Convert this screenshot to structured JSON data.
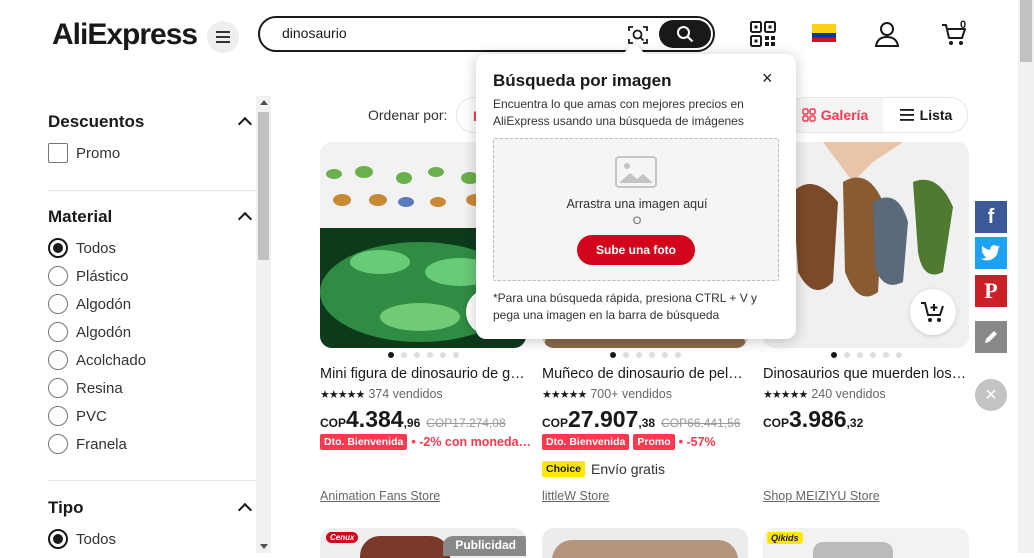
{
  "header": {
    "logo": "AliExpress",
    "search": {
      "value": "dinosaurio",
      "placeholder": ""
    },
    "cart_count": "0"
  },
  "sidebar": {
    "sections": [
      {
        "title": "Descuentos",
        "options": [
          "Promo"
        ]
      },
      {
        "title": "Material",
        "options": [
          "Todos",
          "Plástico",
          "Algodón",
          "Algodón",
          "Acolchado",
          "Resina",
          "PVC",
          "Franela"
        ],
        "selected": "Todos"
      },
      {
        "title": "Tipo",
        "options": [
          "Todos"
        ],
        "selected": "Todos"
      }
    ]
  },
  "toolbar": {
    "sort_label": "Ordenar por:",
    "sort_partial": "F",
    "gallery_label": "Galería",
    "list_label": "Lista"
  },
  "products": [
    {
      "title": "Mini figura de dinosaurio de g…",
      "stars": "★★★★★",
      "sold": "374 vendidos",
      "currency": "COP",
      "price_int": "4.384",
      "price_dec": ",96",
      "old_price": "COP17.274,08",
      "tag": "Dto. Bienvenida",
      "promo_text": "• -2% con moneda…",
      "store": "Animation Fans Store"
    },
    {
      "title": "Muñeco de dinosaurio de pel…",
      "stars": "★★★★★",
      "sold": "700+ vendidos",
      "currency": "COP",
      "price_int": "27.907",
      "price_dec": ",38",
      "old_price": "COP66.441,56",
      "tag": "Dto. Bienvenida",
      "tag2": "Promo",
      "promo_text": "• -57%",
      "choice": "Choice",
      "shipping": "Envío gratis",
      "store": "littleW Store"
    },
    {
      "title": "Dinosaurios que muerden los…",
      "stars": "★★★★★",
      "sold": "240 vendidos",
      "currency": "COP",
      "price_int": "3.986",
      "price_dec": ",32",
      "store": "Shop MEIZIYU Store"
    }
  ],
  "row2": {
    "ad_label": "Publicidad",
    "brand1": "Cenux",
    "brand3": "Qikids"
  },
  "popup": {
    "title": "Búsqueda por imagen",
    "close": "×",
    "description": "Encuentra lo que amas con mejores precios en AliExpress usando una búsqueda de imágenes",
    "drop_text": "Arrastra una imagen aquí",
    "or_text": "O",
    "upload_button": "Sube una foto",
    "hint": "*Para una búsqueda rápida, presiona CTRL + V y pega una imagen en la barra de búsqueda"
  },
  "share": {
    "facebook": "f",
    "pinterest": "P",
    "close": "×"
  },
  "colors": {
    "accent": "#fd384f",
    "upload": "#d3031c",
    "facebook": "#3b5998",
    "twitter": "#1da1f2",
    "pinterest": "#cb2027",
    "edit": "#888888"
  },
  "icons": [
    "menu-icon",
    "camera-search-icon",
    "search-icon",
    "qr-code-icon",
    "colombia-flag-icon",
    "user-icon",
    "cart-icon",
    "gallery-grid-icon",
    "list-icon",
    "add-to-cart-icon",
    "image-placeholder-icon",
    "facebook-icon",
    "twitter-icon",
    "pinterest-icon",
    "edit-icon",
    "close-icon"
  ]
}
